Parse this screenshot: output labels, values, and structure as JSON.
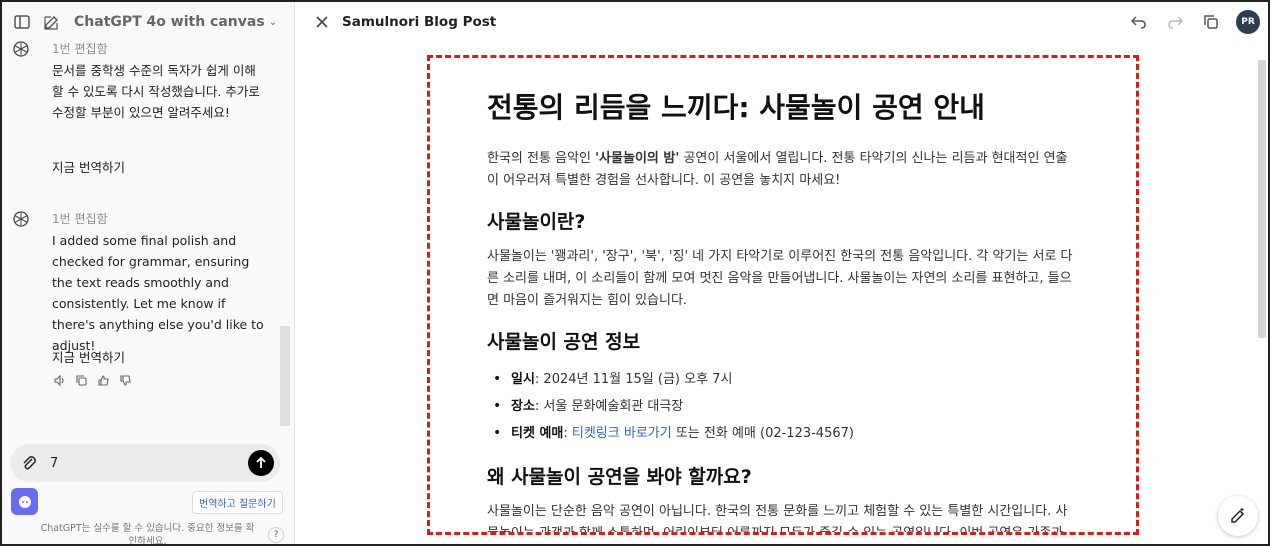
{
  "left_panel": {
    "model_title": "ChatGPT 4o with canvas",
    "messages": [
      {
        "edit_label": "1번 편집함",
        "body": "문서를 중학생 수준의 독자가 쉽게 이해할 수 있도록 다시 작성했습니다. 추가로 수정할 부분이 있으면 알려주세요!",
        "translate": "지금 번역하기"
      },
      {
        "edit_label": "1번 편집함",
        "body": "I added some final polish and checked for grammar, ensuring the text reads smoothly and consistently. Let me know if there's anything else you'd like to adjust!",
        "translate": "지금 번역하기"
      }
    ],
    "composer_value": "7",
    "translate_ask_label": "번역하고 질문하기",
    "footer_note": "ChatGPT는 실수를 할 수 있습니다. 중요한 정보를 확인하세요.",
    "help_label": "?"
  },
  "canvas": {
    "doc_title": "Samulnori Blog Post",
    "avatar_initials": "PR",
    "document": {
      "h1": "전통의 리듬을 느끼다: 사물놀이 공연 안내",
      "intro_pre": "한국의 전통 음악인 ",
      "intro_bold": "'사물놀이의 밤'",
      "intro_post": " 공연이 서울에서 열립니다. 전통 타악기의 신나는 리듬과 현대적인 연출이 어우러져 특별한 경험을 선사합니다. 이 공연을 놓치지 마세요!",
      "h2_what": "사물놀이란?",
      "what_text": "사물놀이는 '꽹과리', '장구', '북', '징' 네 가지 타악기로 이루어진 한국의 전통 음악입니다. 각 악기는 서로 다른 소리를 내며, 이 소리들이 함께 모여 멋진 음악을 만들어냅니다. 사물놀이는 자연의 소리를 표현하고, 들으면 마음이 즐거워지는 힘이 있습니다.",
      "h2_info": "사물놀이 공연 정보",
      "info_date_label": "일시",
      "info_date_value": ": 2024년 11월 15일 (금) 오후 7시",
      "info_place_label": "장소",
      "info_place_value": ": 서울 문화예술회관 대극장",
      "info_ticket_label": "티켓 예매",
      "info_ticket_sep": ": ",
      "info_ticket_link": "티켓링크 바로가기",
      "info_ticket_rest": " 또는 전화 예매 (02-123-4567)",
      "h2_why": "왜 사물놀이 공연을 봐야 할까요?",
      "why_text": "사물놀이는 단순한 음악 공연이 아닙니다. 한국의 전통 문화를 느끼고 체험할 수 있는 특별한 시간입니다. 사물놀이는 관객과 함께 소통하며, 어린이부터 어른까지 모두가 즐길 수 있는 공연입니다. 이번 공연은 가족과"
    }
  },
  "colors": {
    "accent": "#d81b1b",
    "link": "#2b63c9",
    "bot_icon": "#6b6bf0",
    "avatar_bg": "#2e3e50"
  }
}
